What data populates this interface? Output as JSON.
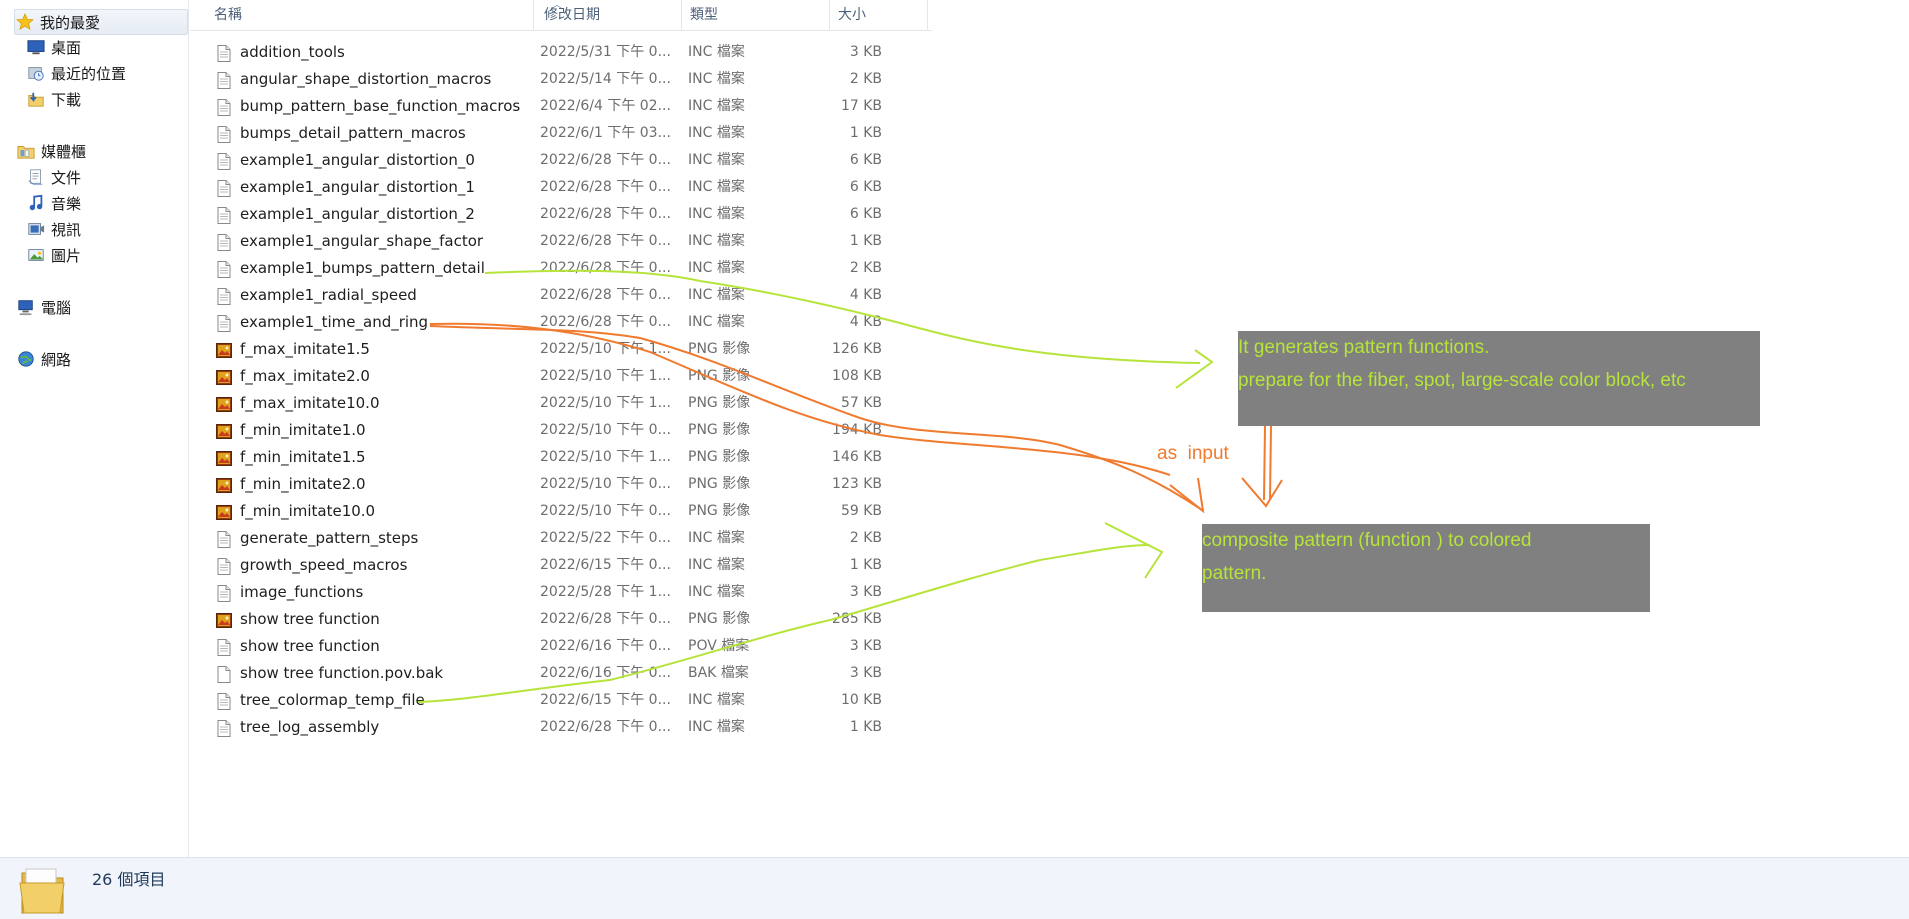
{
  "nav": {
    "favorites": {
      "label": "我的最愛",
      "items": [
        {
          "id": "desktop",
          "label": "桌面",
          "icon": "desktop-icon"
        },
        {
          "id": "recent",
          "label": "最近的位置",
          "icon": "recent-places-icon"
        },
        {
          "id": "downloads",
          "label": "下載",
          "icon": "downloads-icon"
        }
      ]
    },
    "libraries": {
      "label": "媒體櫃",
      "items": [
        {
          "id": "documents",
          "label": "文件",
          "icon": "documents-icon"
        },
        {
          "id": "music",
          "label": "音樂",
          "icon": "music-icon"
        },
        {
          "id": "videos",
          "label": "視訊",
          "icon": "videos-icon"
        },
        {
          "id": "pictures",
          "label": "圖片",
          "icon": "pictures-icon"
        }
      ]
    },
    "computer": {
      "label": "電腦"
    },
    "network": {
      "label": "網路"
    }
  },
  "columns": {
    "name": "名稱",
    "date": "修改日期",
    "type": "類型",
    "size": "大小"
  },
  "files": [
    {
      "name": "addition_tools",
      "date": "2022/5/31 下午 0...",
      "type": "INC 檔案",
      "size": "3 KB",
      "icon": "doc"
    },
    {
      "name": "angular_shape_distortion_macros",
      "date": "2022/5/14 下午 0...",
      "type": "INC 檔案",
      "size": "2 KB",
      "icon": "doc"
    },
    {
      "name": "bump_pattern_base_function_macros",
      "date": "2022/6/4 下午 02...",
      "type": "INC 檔案",
      "size": "17 KB",
      "icon": "doc"
    },
    {
      "name": "bumps_detail_pattern_macros",
      "date": "2022/6/1 下午 03...",
      "type": "INC 檔案",
      "size": "1 KB",
      "icon": "doc"
    },
    {
      "name": "example1_angular_distortion_0",
      "date": "2022/6/28 下午 0...",
      "type": "INC 檔案",
      "size": "6 KB",
      "icon": "doc"
    },
    {
      "name": "example1_angular_distortion_1",
      "date": "2022/6/28 下午 0...",
      "type": "INC 檔案",
      "size": "6 KB",
      "icon": "doc"
    },
    {
      "name": "example1_angular_distortion_2",
      "date": "2022/6/28 下午 0...",
      "type": "INC 檔案",
      "size": "6 KB",
      "icon": "doc"
    },
    {
      "name": "example1_angular_shape_factor",
      "date": "2022/6/28 下午 0...",
      "type": "INC 檔案",
      "size": "1 KB",
      "icon": "doc"
    },
    {
      "name": "example1_bumps_pattern_detail",
      "date": "2022/6/28 下午 0...",
      "type": "INC 檔案",
      "size": "2 KB",
      "icon": "doc"
    },
    {
      "name": "example1_radial_speed",
      "date": "2022/6/28 下午 0...",
      "type": "INC 檔案",
      "size": "4 KB",
      "icon": "doc"
    },
    {
      "name": "example1_time_and_ring",
      "date": "2022/6/28 下午 0...",
      "type": "INC 檔案",
      "size": "4 KB",
      "icon": "doc"
    },
    {
      "name": "f_max_imitate1.5",
      "date": "2022/5/10 下午 1...",
      "type": "PNG 影像",
      "size": "126 KB",
      "icon": "img"
    },
    {
      "name": "f_max_imitate2.0",
      "date": "2022/5/10 下午 1...",
      "type": "PNG 影像",
      "size": "108 KB",
      "icon": "img"
    },
    {
      "name": "f_max_imitate10.0",
      "date": "2022/5/10 下午 1...",
      "type": "PNG 影像",
      "size": "57 KB",
      "icon": "img"
    },
    {
      "name": "f_min_imitate1.0",
      "date": "2022/5/10 下午 0...",
      "type": "PNG 影像",
      "size": "194 KB",
      "icon": "img"
    },
    {
      "name": "f_min_imitate1.5",
      "date": "2022/5/10 下午 1...",
      "type": "PNG 影像",
      "size": "146 KB",
      "icon": "img"
    },
    {
      "name": "f_min_imitate2.0",
      "date": "2022/5/10 下午 0...",
      "type": "PNG 影像",
      "size": "123 KB",
      "icon": "img"
    },
    {
      "name": "f_min_imitate10.0",
      "date": "2022/5/10 下午 0...",
      "type": "PNG 影像",
      "size": "59 KB",
      "icon": "img"
    },
    {
      "name": "generate_pattern_steps",
      "date": "2022/5/22 下午 0...",
      "type": "INC 檔案",
      "size": "2 KB",
      "icon": "doc"
    },
    {
      "name": "growth_speed_macros",
      "date": "2022/6/15 下午 0...",
      "type": "INC 檔案",
      "size": "1 KB",
      "icon": "doc"
    },
    {
      "name": "image_functions",
      "date": "2022/5/28 下午 1...",
      "type": "INC 檔案",
      "size": "3 KB",
      "icon": "doc"
    },
    {
      "name": "show tree function",
      "date": "2022/6/28 下午 0...",
      "type": "PNG 影像",
      "size": "285 KB",
      "icon": "img"
    },
    {
      "name": "show tree function",
      "date": "2022/6/16 下午 0...",
      "type": "POV 檔案",
      "size": "3 KB",
      "icon": "doc"
    },
    {
      "name": "show tree function.pov.bak",
      "date": "2022/6/16 下午 0...",
      "type": "BAK 檔案",
      "size": "3 KB",
      "icon": "blank"
    },
    {
      "name": "tree_colormap_temp_file",
      "date": "2022/6/15 下午 0...",
      "type": "INC 檔案",
      "size": "10 KB",
      "icon": "doc"
    },
    {
      "name": "tree_log_assembly",
      "date": "2022/6/28 下午 0...",
      "type": "INC 檔案",
      "size": "1 KB",
      "icon": "doc"
    }
  ],
  "status": {
    "item_count": "26 個項目"
  },
  "annotations": {
    "note1": [
      "It generates pattern functions.",
      "prepare  for the fiber, spot, large-scale color block, etc"
    ],
    "note2": [
      "composite pattern (function )  to colored",
      "pattern."
    ],
    "input_label": "as  input",
    "colors": {
      "green": "#b6e43a",
      "orange": "#f07a2e",
      "box": "#808080"
    }
  }
}
